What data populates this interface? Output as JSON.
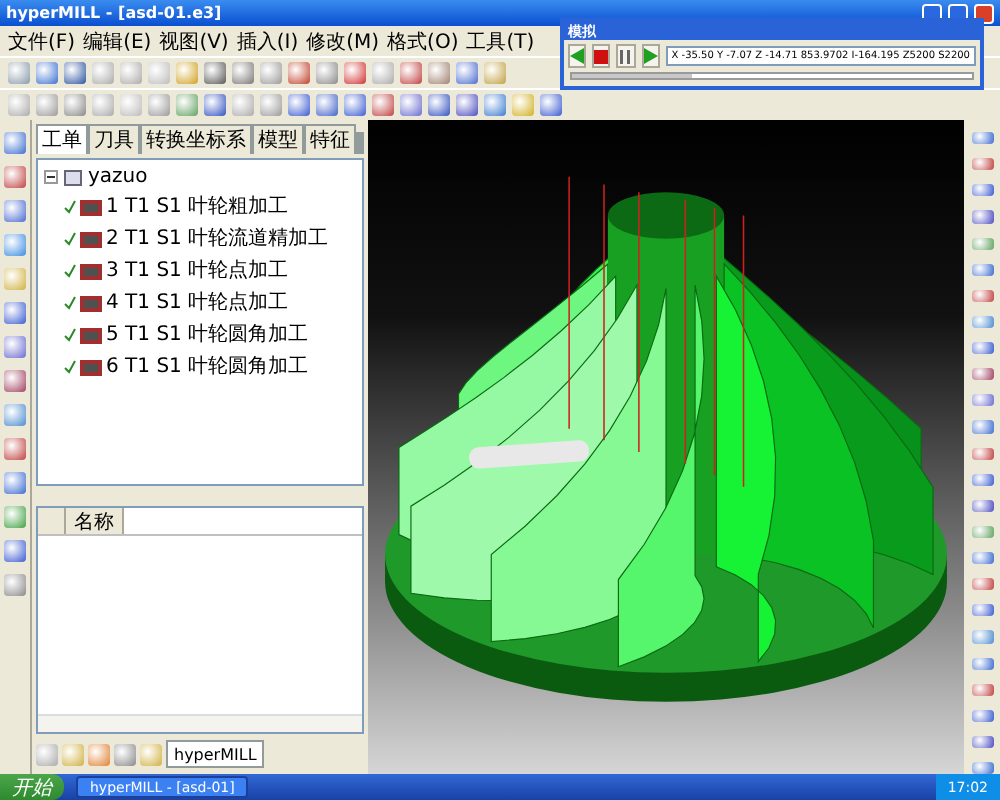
{
  "window": {
    "title": "hyperMILL - [asd-01.e3]"
  },
  "menu": [
    {
      "label": "文件(F)"
    },
    {
      "label": "编辑(E)"
    },
    {
      "label": "视图(V)"
    },
    {
      "label": "插入(I)"
    },
    {
      "label": "修改(M)"
    },
    {
      "label": "格式(O)"
    },
    {
      "label": "工具(T)"
    }
  ],
  "left_panel": {
    "tabs": [
      {
        "label": "工单",
        "selected": true
      },
      {
        "label": "刀具",
        "selected": false
      },
      {
        "label": "转换坐标系",
        "selected": false
      },
      {
        "label": "模型",
        "selected": false
      },
      {
        "label": "特征",
        "selected": false
      }
    ],
    "tree": {
      "label": "yazuo",
      "expanded": true,
      "children": [
        {
          "label": "1  T1  S1  叶轮粗加工",
          "checked": true
        },
        {
          "label": "2  T1  S1  叶轮流道精加工",
          "checked": true
        },
        {
          "label": "3  T1  S1  叶轮点加工",
          "checked": true
        },
        {
          "label": "4  T1  S1  叶轮点加工",
          "checked": true
        },
        {
          "label": "5  T1  S1  叶轮圆角加工",
          "checked": true
        },
        {
          "label": "6  T1  S1  叶轮圆角加工",
          "checked": true
        }
      ]
    },
    "list": {
      "columns": [
        "名称"
      ]
    },
    "bottom_tab": "hyperMILL"
  },
  "simulation_dialog": {
    "title": "模拟",
    "readout": "X -35.50  Y -7.07  Z -14.71  853.9702  I-164.195  Z5200  S2200",
    "progress": {
      "level": 0.3
    }
  },
  "taskbar": {
    "start": "开始",
    "tasks": [
      {
        "label": "hyperMILL - [asd-01]"
      }
    ],
    "clock": "17:02"
  }
}
